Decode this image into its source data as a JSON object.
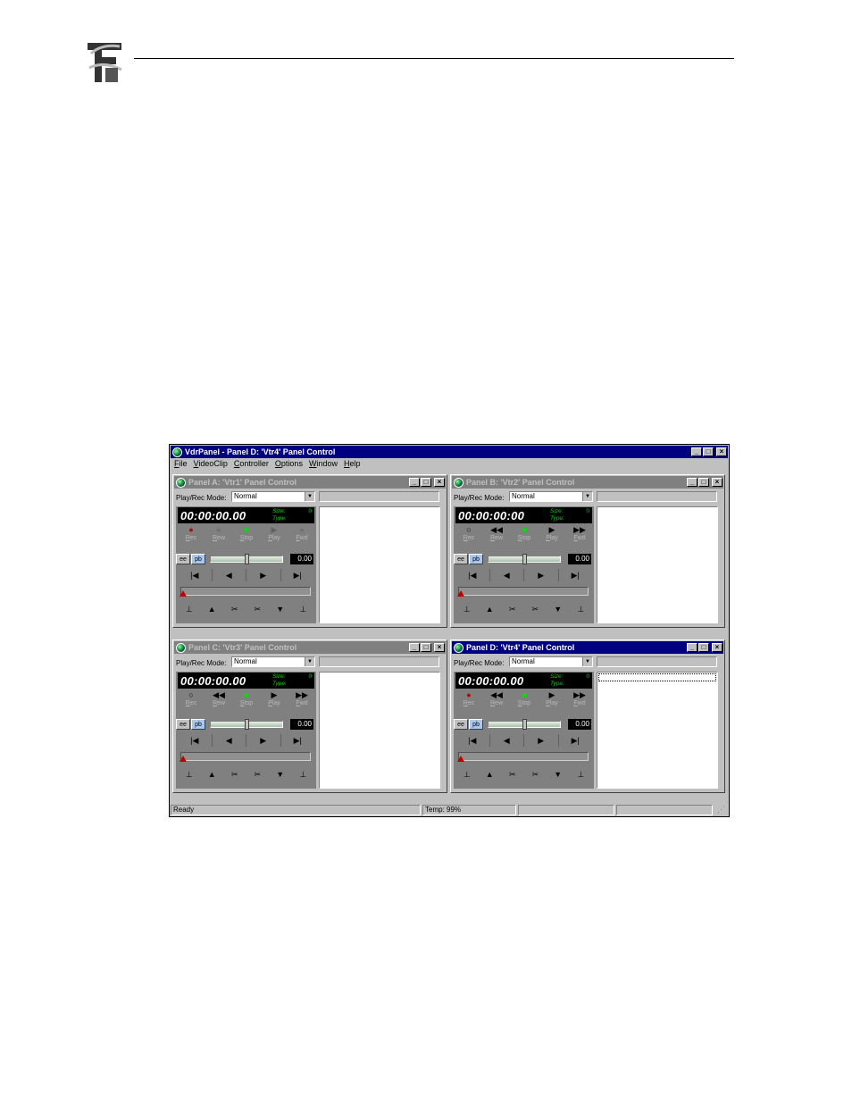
{
  "app": {
    "title": "VdrPanel - Panel D: 'Vtr4' Panel Control",
    "menu": [
      {
        "key": "F",
        "rest": "ile"
      },
      {
        "key": "V",
        "rest": "ideoClip"
      },
      {
        "key": "C",
        "rest": "ontroller"
      },
      {
        "key": "O",
        "rest": "ptions"
      },
      {
        "key": "W",
        "rest": "indow"
      },
      {
        "key": "H",
        "rest": "elp"
      }
    ],
    "status": {
      "left": "Ready",
      "temp": "Temp: 99%"
    }
  },
  "labels": {
    "mode_label": "Play/Rec Mode:",
    "size_label": "Size:",
    "type_label": "Type:",
    "ee": "ee",
    "pb": "pb",
    "rec": {
      "key": "R",
      "rest": "ec"
    },
    "rew": {
      "key": "R",
      "rest": "ew"
    },
    "stop": {
      "key": "S",
      "rest": "top"
    },
    "play": {
      "key": "P",
      "rest": "lay"
    },
    "fwd": {
      "key": "F",
      "rest": "wd"
    }
  },
  "panels": [
    {
      "title": "Panel A: 'Vtr1' Panel Control",
      "mode": "Normal",
      "timecode": "00:00:00.00",
      "size": "0",
      "type": "",
      "speed": "0.00",
      "shuttle_fraction": 0.5,
      "scrub_fraction": 0,
      "active": false
    },
    {
      "title": "Panel B: 'Vtr2' Panel Control",
      "mode": "Normal",
      "timecode": "00:00:00:00",
      "size": "0",
      "type": "",
      "speed": "0.00",
      "shuttle_fraction": 0.5,
      "scrub_fraction": 0,
      "active": false
    },
    {
      "title": "Panel C: 'Vtr3' Panel Control",
      "mode": "Normal",
      "timecode": "00:00:00.00",
      "size": "0",
      "type": "",
      "speed": "0.00",
      "shuttle_fraction": 0.5,
      "scrub_fraction": 0,
      "active": false
    },
    {
      "title": "Panel D: 'Vtr4' Panel Control",
      "mode": "Normal",
      "timecode": "00:00:00.00",
      "size": "0",
      "type": "",
      "speed": "0.00",
      "shuttle_fraction": 0.5,
      "scrub_fraction": 0,
      "active": true
    }
  ],
  "colors": {
    "active_title": "#000080",
    "inactive_title": "#808080",
    "rec_red": "#c00000",
    "stop_green": "#00e000",
    "timecode_bg": "#000000"
  },
  "icons": [
    "logo-icon",
    "app-icon",
    "minimize-icon",
    "maximize-icon",
    "close-icon",
    "record-icon",
    "rewind-icon",
    "stop-icon",
    "play-icon",
    "fast-forward-icon",
    "go-to-start-icon",
    "step-back-icon",
    "step-forward-icon",
    "go-to-end-icon",
    "mark-in-icon",
    "mark-out-icon",
    "cut-icon",
    "size-grip-icon"
  ]
}
